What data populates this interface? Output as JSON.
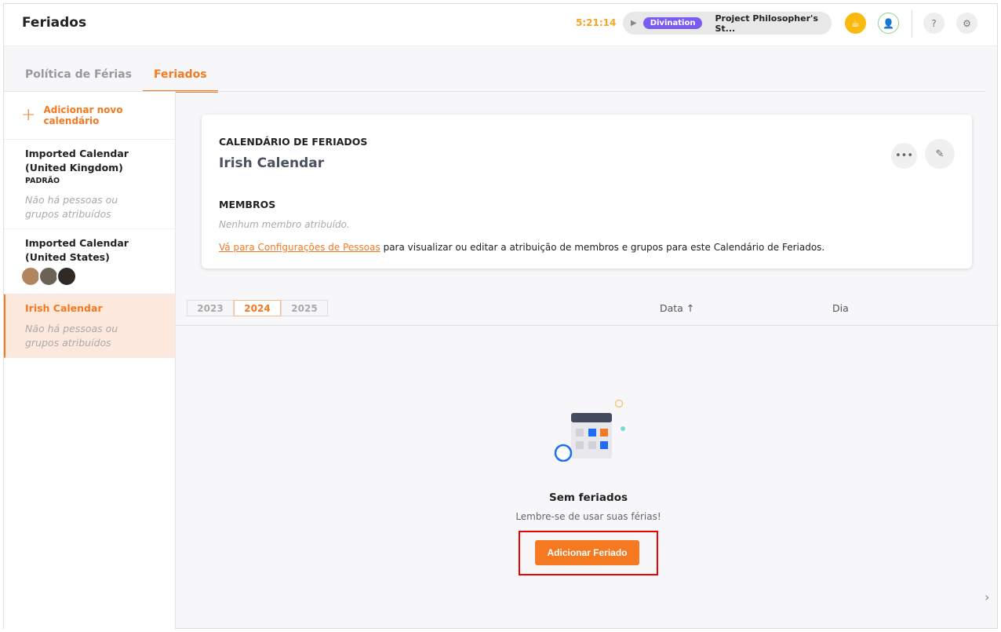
{
  "header": {
    "title": "Feriados",
    "timer": "5:21:14",
    "tag": "Divination",
    "project": "Project Philosopher's St..."
  },
  "tabs": [
    {
      "label": "Política de Férias"
    },
    {
      "label": "Feriados"
    }
  ],
  "sidebar": {
    "add_label": "Adicionar novo calendário",
    "items": [
      {
        "name": "Imported Calendar (United Kingdom)",
        "badge": "PADRÃO",
        "empty": "Não há pessoas ou grupos atribuídos"
      },
      {
        "name": "Imported Calendar (United States)"
      },
      {
        "name": "Irish Calendar",
        "empty": "Não há pessoas ou grupos atribuídos"
      }
    ]
  },
  "card": {
    "heading": "CALENDÁRIO DE FERIADOS",
    "name": "Irish Calendar",
    "members_heading": "MEMBROS",
    "no_members": "Nenhum membro atribuído.",
    "link": "Vá para Configurações de Pessoas",
    "link_rest": " para visualizar ou editar a atribuição de membros e grupos para este Calendário de Feriados."
  },
  "years": [
    "2023",
    "2024",
    "2025"
  ],
  "columns": {
    "date": "Data",
    "day": "Dia"
  },
  "empty_state": {
    "title": "Sem feriados",
    "subtitle": "Lembre-se de usar suas férias!",
    "button": "Adicionar Feriado"
  },
  "colors": {
    "accent": "#f47920",
    "tag": "#7b5cf0",
    "timer": "#f5a623"
  }
}
